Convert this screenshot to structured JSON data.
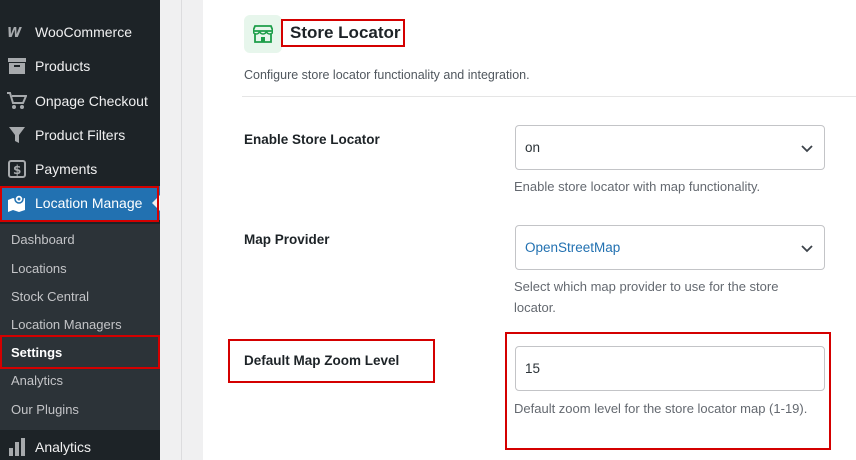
{
  "sidebar": {
    "items": [
      {
        "label": "WooCommerce",
        "icon": "woo-icon"
      },
      {
        "label": "Products",
        "icon": "archive-icon"
      },
      {
        "label": "Onpage Checkout",
        "icon": "cart-icon"
      },
      {
        "label": "Product Filters",
        "icon": "filter-icon"
      },
      {
        "label": "Payments",
        "icon": "dollar-icon"
      },
      {
        "label": "Location Manage",
        "icon": "map-icon"
      }
    ],
    "submenu": [
      "Dashboard",
      "Locations",
      "Stock Central",
      "Location Managers",
      "Settings",
      "Analytics",
      "Our Plugins"
    ],
    "bottom_item": {
      "label": "Analytics",
      "icon": "chart-icon"
    }
  },
  "section": {
    "title": "Store Locator",
    "description": "Configure store locator functionality and integration."
  },
  "fields": {
    "enable": {
      "label": "Enable Store Locator",
      "value": "on",
      "help": "Enable store locator with map functionality."
    },
    "provider": {
      "label": "Map Provider",
      "value": "OpenStreetMap",
      "help": "Select which map provider to use for the store locator."
    },
    "zoom": {
      "label": "Default Map Zoom Level",
      "value": "15",
      "help": "Default zoom level for the store locator map (1-19)."
    }
  },
  "colors": {
    "highlight": "#d40000",
    "accent": "#2271b1",
    "sidebar": "#1d2327"
  }
}
